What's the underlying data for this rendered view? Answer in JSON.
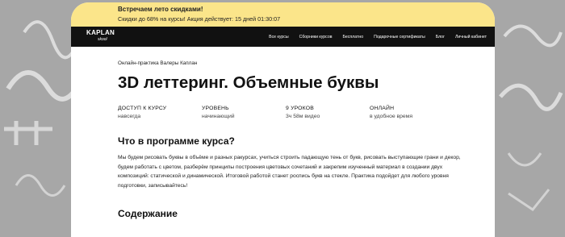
{
  "promo": {
    "line1": "Встречаем лето скидками!",
    "line2": "Скидки до 68% на курсы! Акция действует: 15 дней 01:30:07"
  },
  "logo": {
    "main": "KAPLAN",
    "sub": "skool"
  },
  "nav": [
    "Все курсы",
    "Сборники курсов",
    "Бесплатно",
    "Подарочные сертификаты",
    "Блог",
    "Личный кабинет"
  ],
  "course": {
    "author": "Онлайн-практика Валеры Каплан",
    "title": "3D леттеринг. Объемные буквы",
    "meta": [
      {
        "label": "ДОСТУП К КУРСУ",
        "value": "навсегда"
      },
      {
        "label": "УРОВЕНЬ",
        "value": "начинающий"
      },
      {
        "label": "9 УРОКОВ",
        "value": "3ч 58м видео"
      },
      {
        "label": "ОНЛАЙН",
        "value": "в удобное время"
      }
    ],
    "program_heading": "Что в программе курса?",
    "description": "Мы будем рисовать буквы в объёме и разных ракурсах, учиться строить падающую тень от букв, рисовать выступающие грани и декор, будем работать с цветом, разберём принципы построения цветовых сочетаний и закрепим изученный материал в создании двух композиций: статической и динамической. Итоговой работой станет роспись букв на стекле. Практика подойдет для любого уровня подготовки, записывайтесь!",
    "contents_heading": "Содержание"
  },
  "colors": {
    "promo_bg": "#fbe58a",
    "nav_bg": "#111111",
    "page_bg": "#a7a7a7"
  }
}
